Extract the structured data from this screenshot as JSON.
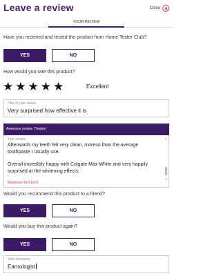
{
  "header": {
    "title": "Leave a review",
    "close_label": "Close"
  },
  "tabs": {
    "active_label": "YOUR REVIEW"
  },
  "q_tested": {
    "question": "Have you received and tested the product from Home Tester Club?",
    "yes_label": "YES",
    "no_label": "NO",
    "selected": "YES"
  },
  "rating": {
    "question": "How would you rate this product?",
    "stars": [
      "★",
      "★",
      "★",
      "★",
      "★"
    ],
    "value": 5,
    "max": 5,
    "text": "Excellent"
  },
  "review_title": {
    "label": "Title of your review",
    "value": "Very surprised how effective it is"
  },
  "banner": {
    "text": "Awesome review. Thanks!"
  },
  "review_body": {
    "label": "Your review",
    "paragraph1": "Afterwards my teeth felt very clean, moreso than the average toothpaste I usually use.",
    "paragraph2": "Overall incredibly happy with Colgate Max White and very happily surprised at the whitening effects.",
    "max_text": "Maximum Text Limit"
  },
  "q_recommend": {
    "question": "Would you recommend this product to a friend?",
    "yes_label": "YES",
    "no_label": "NO",
    "selected": "YES"
  },
  "q_buy": {
    "question": "Would you buy this product again?",
    "yes_label": "YES",
    "no_label": "NO",
    "selected": "YES"
  },
  "nickname": {
    "label": "Your nickname",
    "value": "Earnologist"
  },
  "colors": {
    "primary": "#3b1a66",
    "title": "#4a2272",
    "accent": "#e0245e"
  }
}
